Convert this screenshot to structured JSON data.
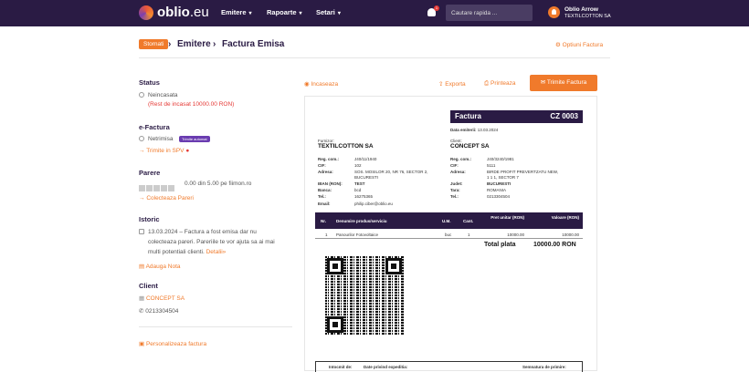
{
  "nav": {
    "logo": "oblio",
    "logo_suffix": ".eu",
    "menu": [
      "Emitere",
      "Rapoarte",
      "Setari"
    ],
    "notifications": "1",
    "search_placeholder": "Cautare rapida ...",
    "user_name": "Oblio Arrow",
    "user_company": "TEXTILCOTTON SA"
  },
  "breadcrumb": {
    "back": "Stornati",
    "items": [
      "Emitere",
      "Factura Emisa"
    ],
    "options": "Optiuni Factura"
  },
  "side": {
    "status_title": "Status",
    "status_value": "Neincasata",
    "status_remaining": "(Rest de incasat 10000.00 RON)",
    "efactura_title": "e-Factura",
    "efactura_value": "Netrimisa",
    "efactura_badge": "Trimite automat",
    "efactura_link": "Trimite in SPV",
    "parere_title": "Parere",
    "parere_rating": "0.00 din 5.00 pe fiimon.ro",
    "parere_link": "Colecteaza Pareri",
    "istoric_title": "Istoric",
    "istoric_line1": "13.03.2024 – Factura a fost emisa dar nu",
    "istoric_line2": "colecteaza pareri. Pareriile te vor ajuta sa ai mai",
    "istoric_line3": "multi potentiali clienti.",
    "istoric_detalii": "Detalii»",
    "add_note": "Adauga Nota",
    "client_title": "Client",
    "client_name": "CONCEPT SA",
    "client_phone": "0213304504",
    "personalize": "Personalizeaza factura"
  },
  "actions": {
    "incaseaza": "Incaseaza",
    "exporta": "Exporta",
    "printeaza": "Printeaza",
    "trimite": "Trimite Factura"
  },
  "invoice": {
    "title": "Factura",
    "number": "CZ 0003",
    "date_label": "Data emiterii:",
    "date": "13.03.2024",
    "supplier_label": "Furnizor:",
    "supplier": "TEXTILCOTTON SA",
    "client_label": "Client:",
    "client": "CONCEPT SA",
    "supplier_fields": [
      [
        "Reg. com.:",
        "J40/11/1940"
      ],
      [
        "CIF:",
        "102"
      ],
      [
        "Adresa:",
        "SOS. MOSILOR 20, NR 76, SECTOR 2,"
      ],
      [
        "",
        "BUCURESTI"
      ],
      [
        "IBAN (RON):",
        "TEST"
      ],
      [
        "Banca:",
        "bcd"
      ],
      [
        "Tel.:",
        "16275365"
      ],
      [
        "Email:",
        "philip.ciber@oblio.eu"
      ]
    ],
    "client_fields": [
      [
        "Reg. com.:",
        "J40/3240/1981"
      ],
      [
        "CIF:",
        "5111"
      ],
      [
        "Adresa:",
        "BIRDE PROFIT PREVERTZATU NEW,"
      ],
      [
        "",
        "1 1 1, SECTOR 7"
      ],
      [
        "Judet:",
        "BUCURESTI"
      ],
      [
        "Tara:",
        "ROMANIA"
      ],
      [
        "Tel.:",
        "0213304504"
      ]
    ],
    "columns": [
      "Nr.",
      "Denumire produs/serviciu",
      "U.M.",
      "Cant.",
      "Pret unitar (RON)",
      "Valoare (RON)"
    ],
    "rows": [
      [
        "1",
        "Panourilor Fotovoltaice",
        "buc",
        "1",
        "10000.00",
        "10000.00"
      ]
    ],
    "total_label": "Total plata",
    "total_value": "10000.00 RON",
    "footer_1": "Intocmit de:",
    "footer_2": "Date privind expeditia:",
    "footer_3": "Semnatura de primire:"
  }
}
